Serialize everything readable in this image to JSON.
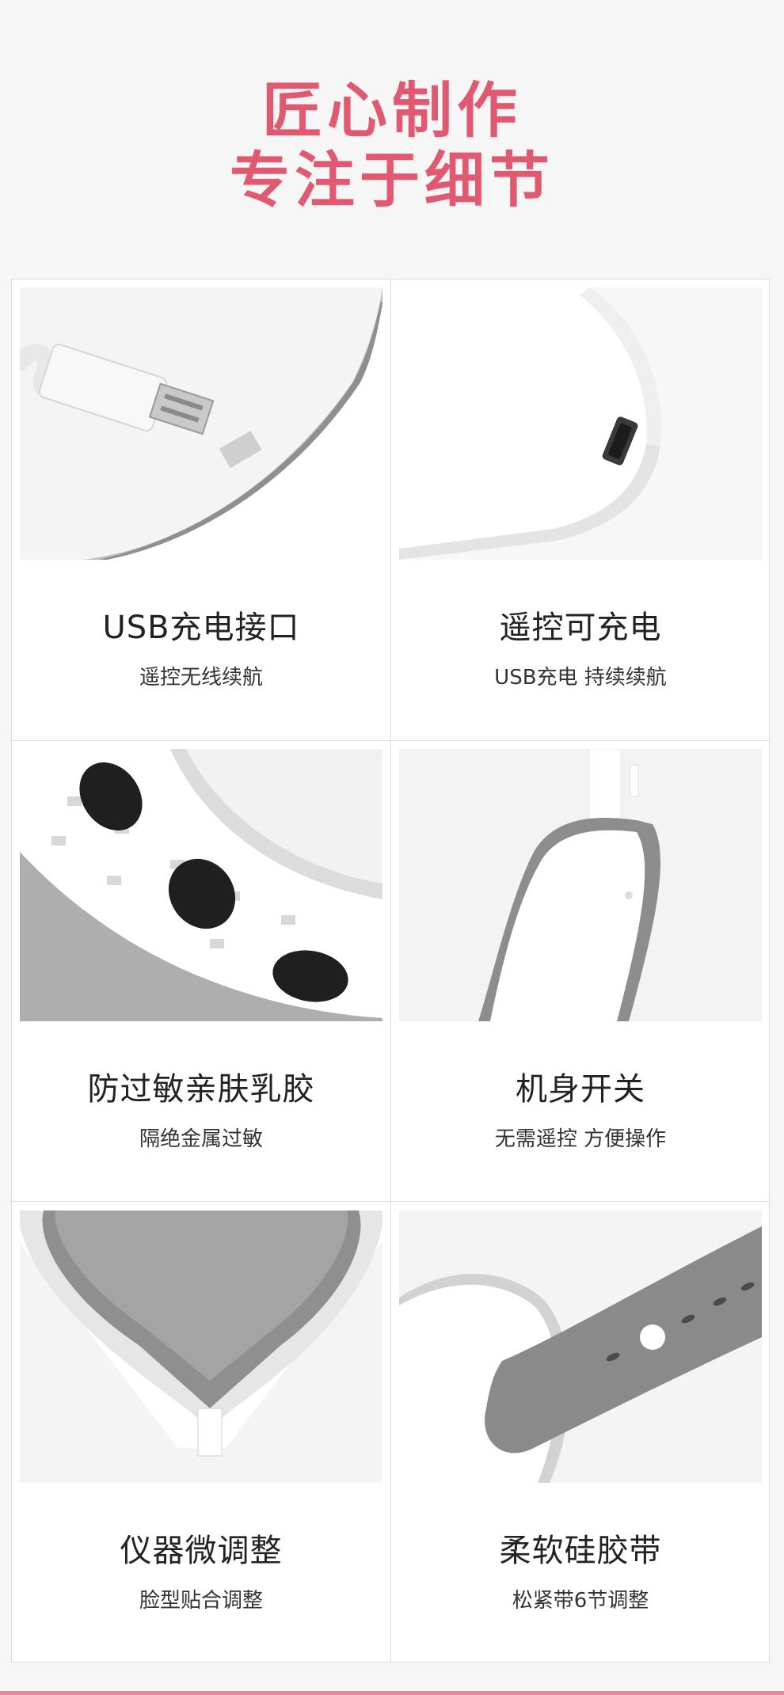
{
  "header": {
    "line1": "匠心制作",
    "line2": "专注于细节",
    "accent_color": "#e15871"
  },
  "features": [
    {
      "title": "USB充电接口",
      "subtitle": "遥控无线续航",
      "image": "usb-cable-port-photo"
    },
    {
      "title": "遥控可充电",
      "subtitle": "USB充电 持续续航",
      "image": "remote-charging-port-photo"
    },
    {
      "title": "防过敏亲肤乳胶",
      "subtitle": "隔绝金属过敏",
      "image": "electrode-pads-photo"
    },
    {
      "title": "机身开关",
      "subtitle": "无需遥控 方便操作",
      "image": "power-switch-photo"
    },
    {
      "title": "仪器微调整",
      "subtitle": "脸型贴合调整",
      "image": "v-shape-hinge-photo"
    },
    {
      "title": "柔软硅胶带",
      "subtitle": "松紧带6节调整",
      "image": "silicone-strap-photo"
    }
  ]
}
